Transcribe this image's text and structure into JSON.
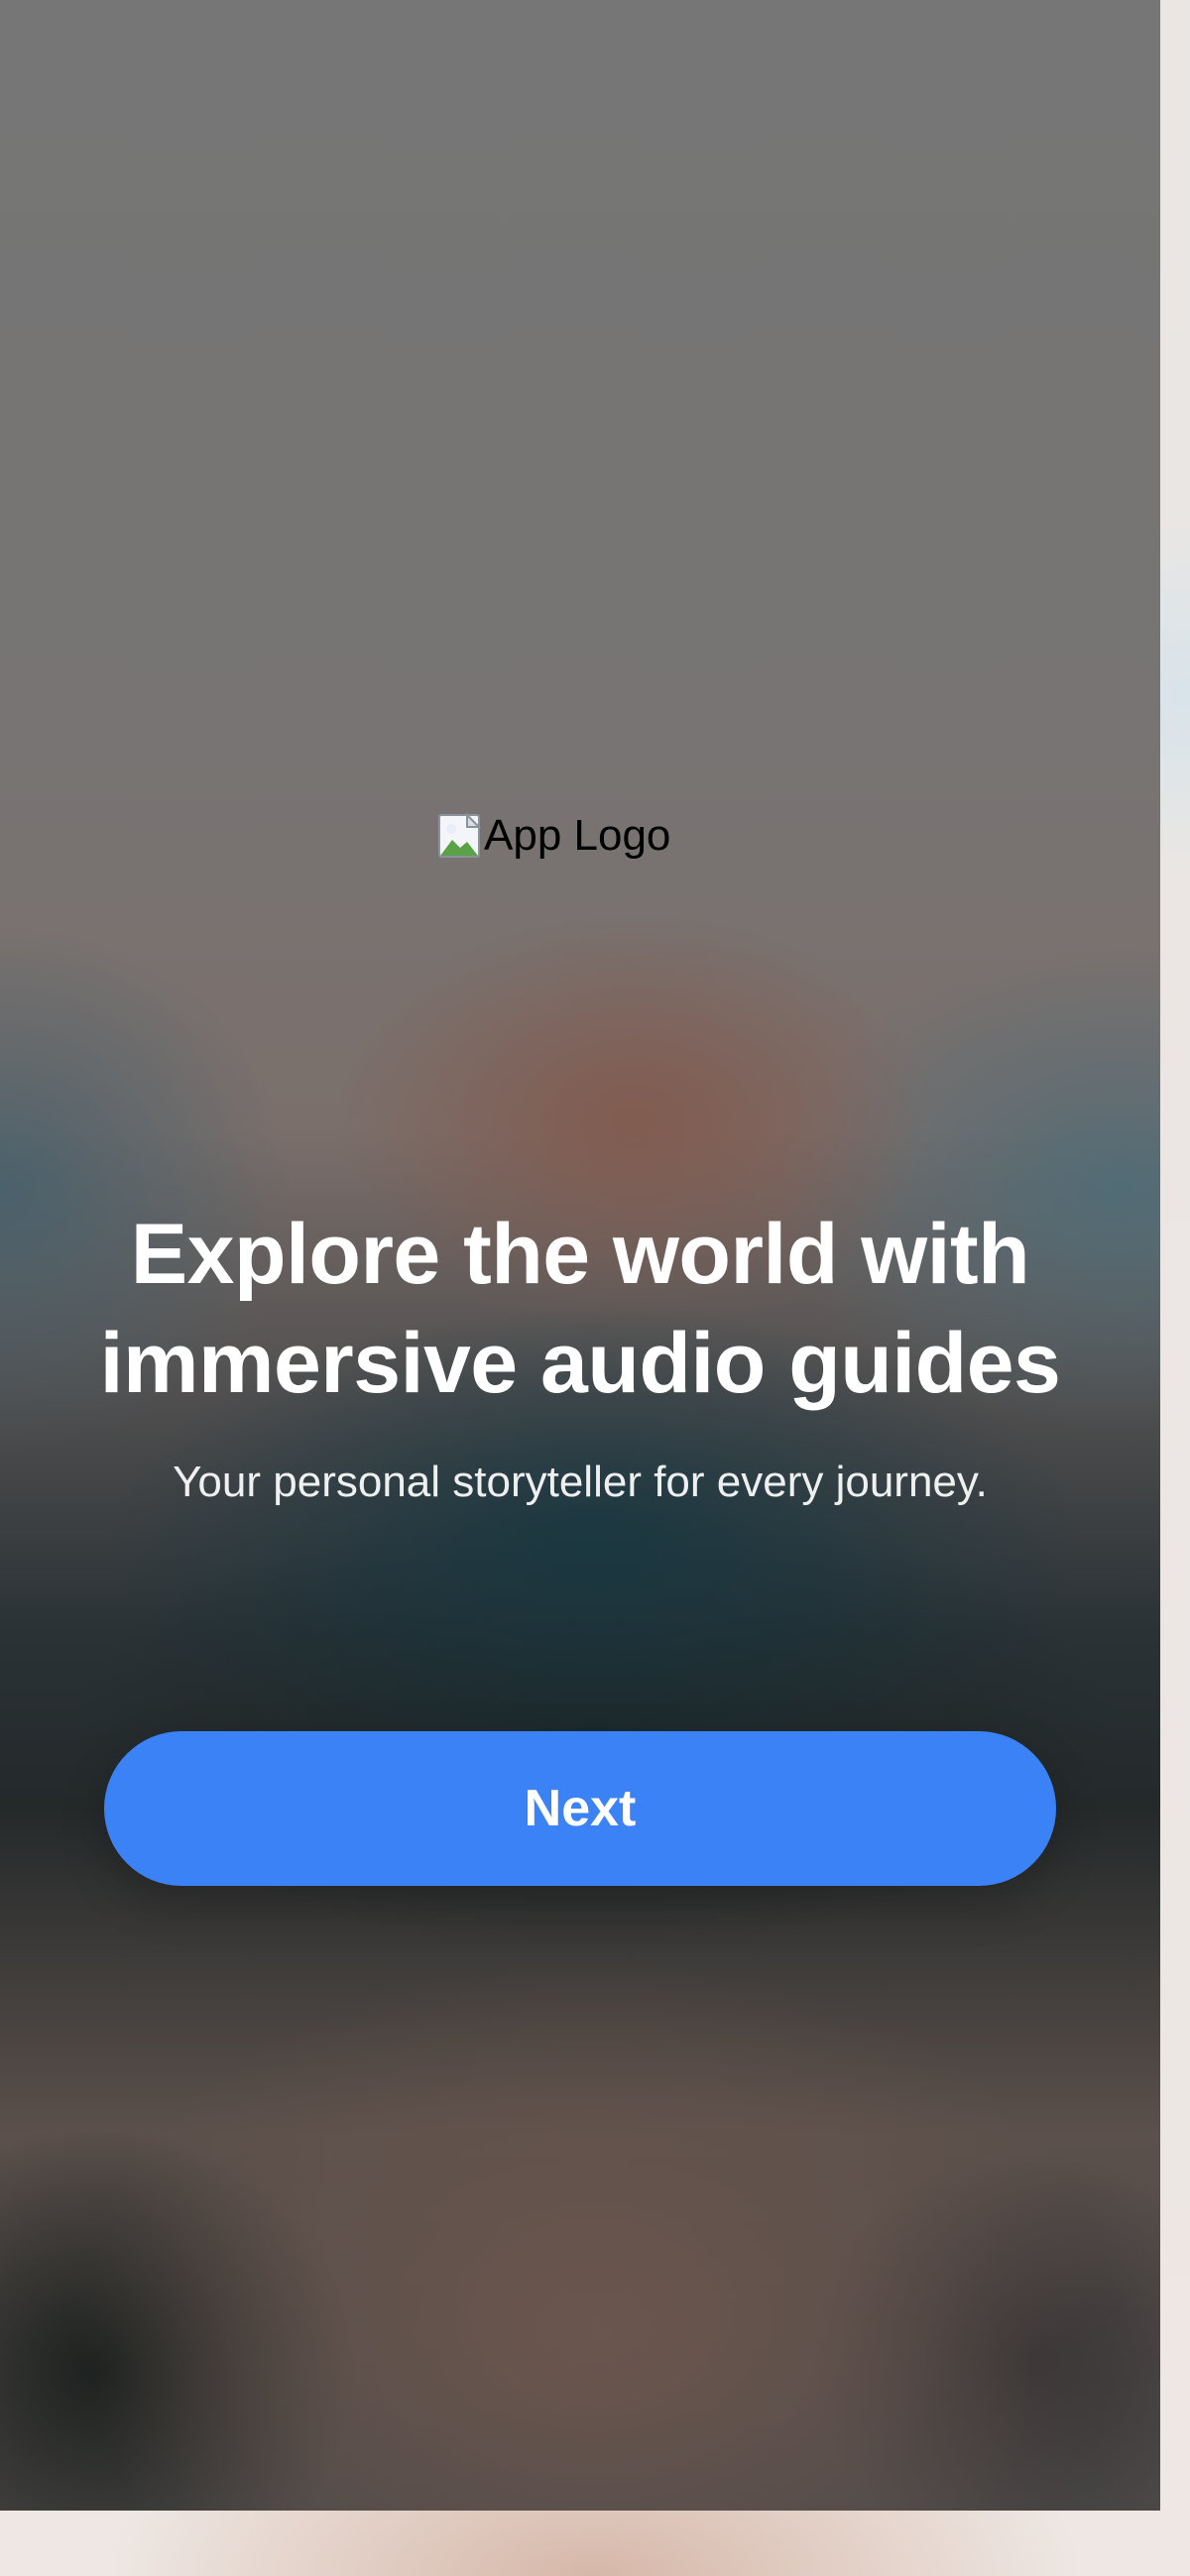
{
  "logo": {
    "alt_text": "App Logo",
    "icon": "broken-image-icon"
  },
  "hero": {
    "title": "Explore the world with immersive audio guides",
    "subtitle": "Your personal storyteller for every journey."
  },
  "actions": {
    "next_label": "Next"
  },
  "colors": {
    "primary_button": "#3b82f6",
    "text_primary": "#ffffff",
    "logo_text": "#000000"
  }
}
